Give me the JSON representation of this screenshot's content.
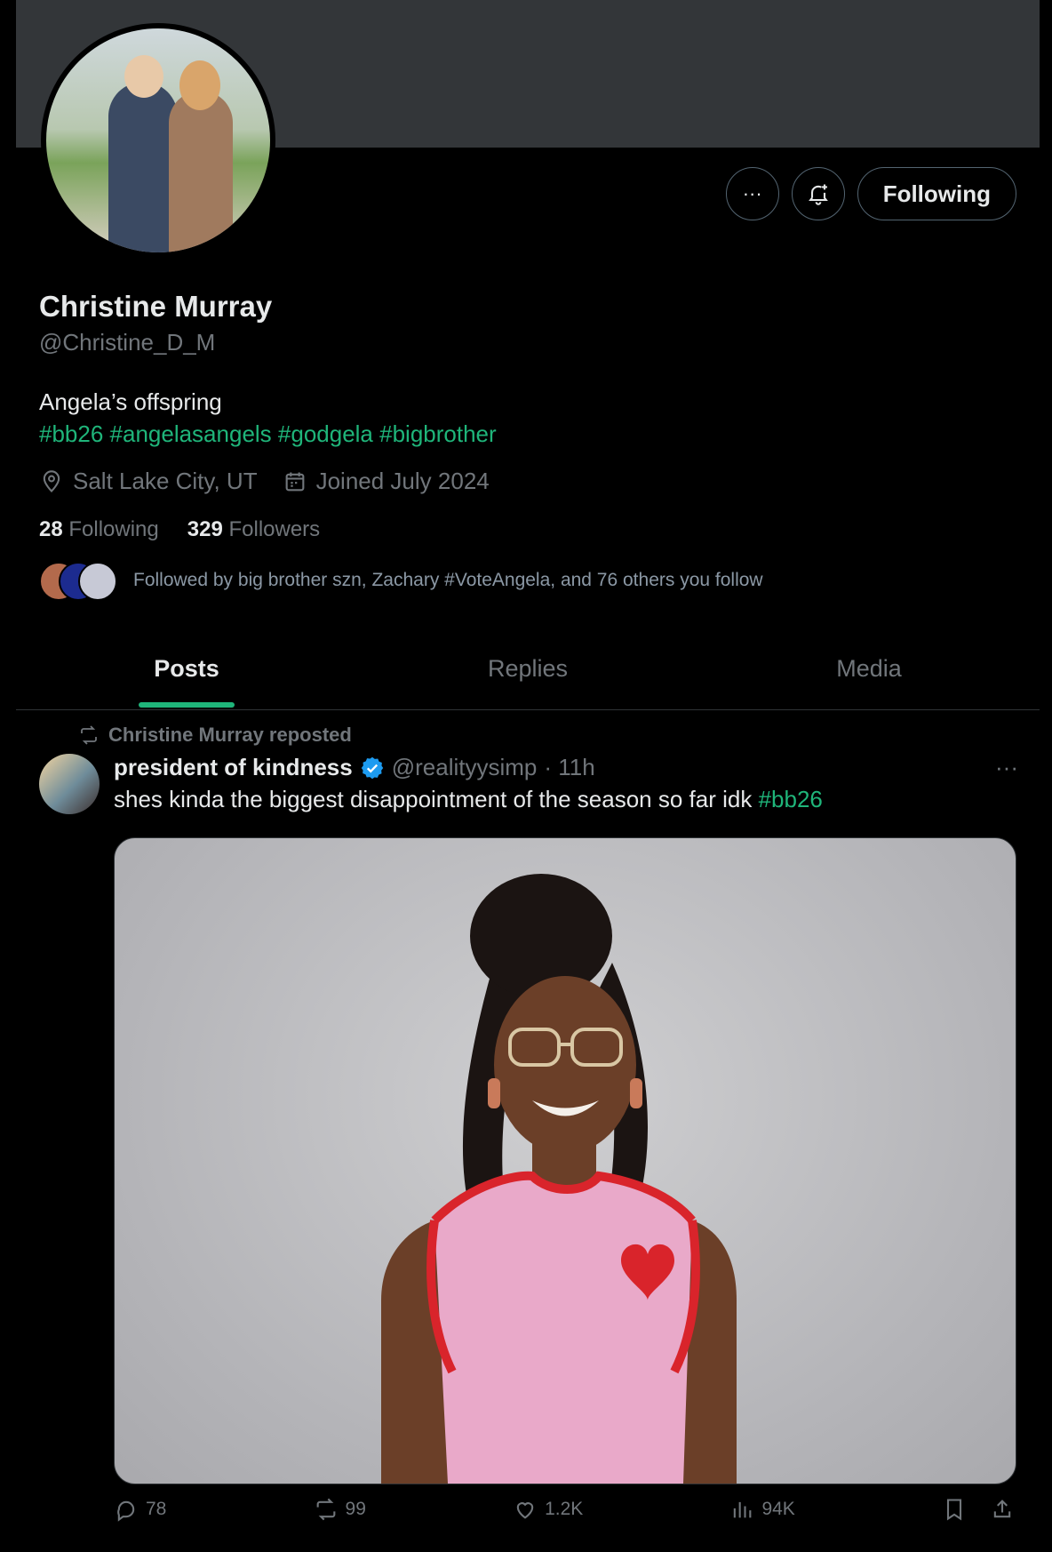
{
  "profile": {
    "name": "Christine Murray",
    "handle": "@Christine_D_M",
    "bio_line": "Angela’s offspring",
    "bio_tags": "#bb26 #angelasangels #godgela #bigbrother",
    "location": "Salt Lake City, UT",
    "joined": "Joined July 2024",
    "following_count": "28",
    "following_label": "Following",
    "followers_count": "329",
    "followers_label": "Followers",
    "followed_by": "Followed by big brother szn, Zachary #VoteAngela, and 76 others you follow"
  },
  "actions": {
    "more_label": "···",
    "following_button": "Following"
  },
  "tabs": [
    {
      "label": "Posts",
      "active": true
    },
    {
      "label": "Replies",
      "active": false
    },
    {
      "label": "Media",
      "active": false
    }
  ],
  "post": {
    "repost_text": "Christine Murray reposted",
    "author": "president of kindness",
    "author_handle": "@realityysimp",
    "time": "· 11h",
    "text": "shes kinda the biggest disappointment of the season so far idk ",
    "text_tag": "#bb26",
    "replies": "78",
    "reposts": "99",
    "likes": "1.2K",
    "views": "94K"
  },
  "colors": {
    "accent": "#1fb57a",
    "verified": "#1d9bf0",
    "muted": "#71767b",
    "banner": "#333639"
  }
}
